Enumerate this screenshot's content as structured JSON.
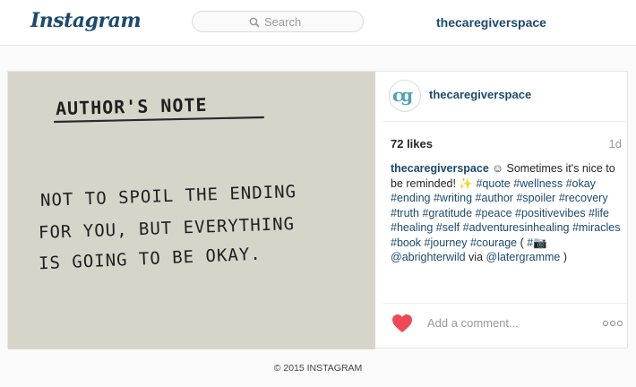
{
  "header": {
    "logo": "Instagram",
    "search_placeholder": "Search",
    "username": "thecaregiverspace"
  },
  "post": {
    "image": {
      "title": "AUTHOR'S NOTE",
      "lines": [
        "NOT TO SPOIL THE ENDING",
        "FOR YOU, BUT EVERYTHING",
        "IS GOING TO BE OKAY."
      ]
    },
    "avatar_text": "cg",
    "username": "thecaregiverspace",
    "likes": "72 likes",
    "age": "1d",
    "caption": {
      "user": "thecaregiverspace",
      "text": " ☺ Sometimes it's nice to be reminded! ✨",
      "tags": [
        "#quote",
        "#wellness",
        "#okay",
        "#ending",
        "#writing",
        "#author",
        "#spoiler",
        "#recovery",
        "#truth",
        "#gratitude",
        "#peace",
        "#positivevibes",
        "#life",
        "#healing",
        "#self",
        "#adventuresinhealing",
        "#miracles",
        "#book",
        "#journey",
        "#courage"
      ],
      "suffix_open": " ( ",
      "camera_tag": "#📷",
      "mention1": "@abrighterwild",
      "via": " via ",
      "mention2": "@latergramme",
      "suffix_close": " )"
    },
    "comment_placeholder": "Add a comment...",
    "heart_color": "#ed4956"
  },
  "footer": {
    "copyright": "© 2015 INSTAGRAM"
  }
}
